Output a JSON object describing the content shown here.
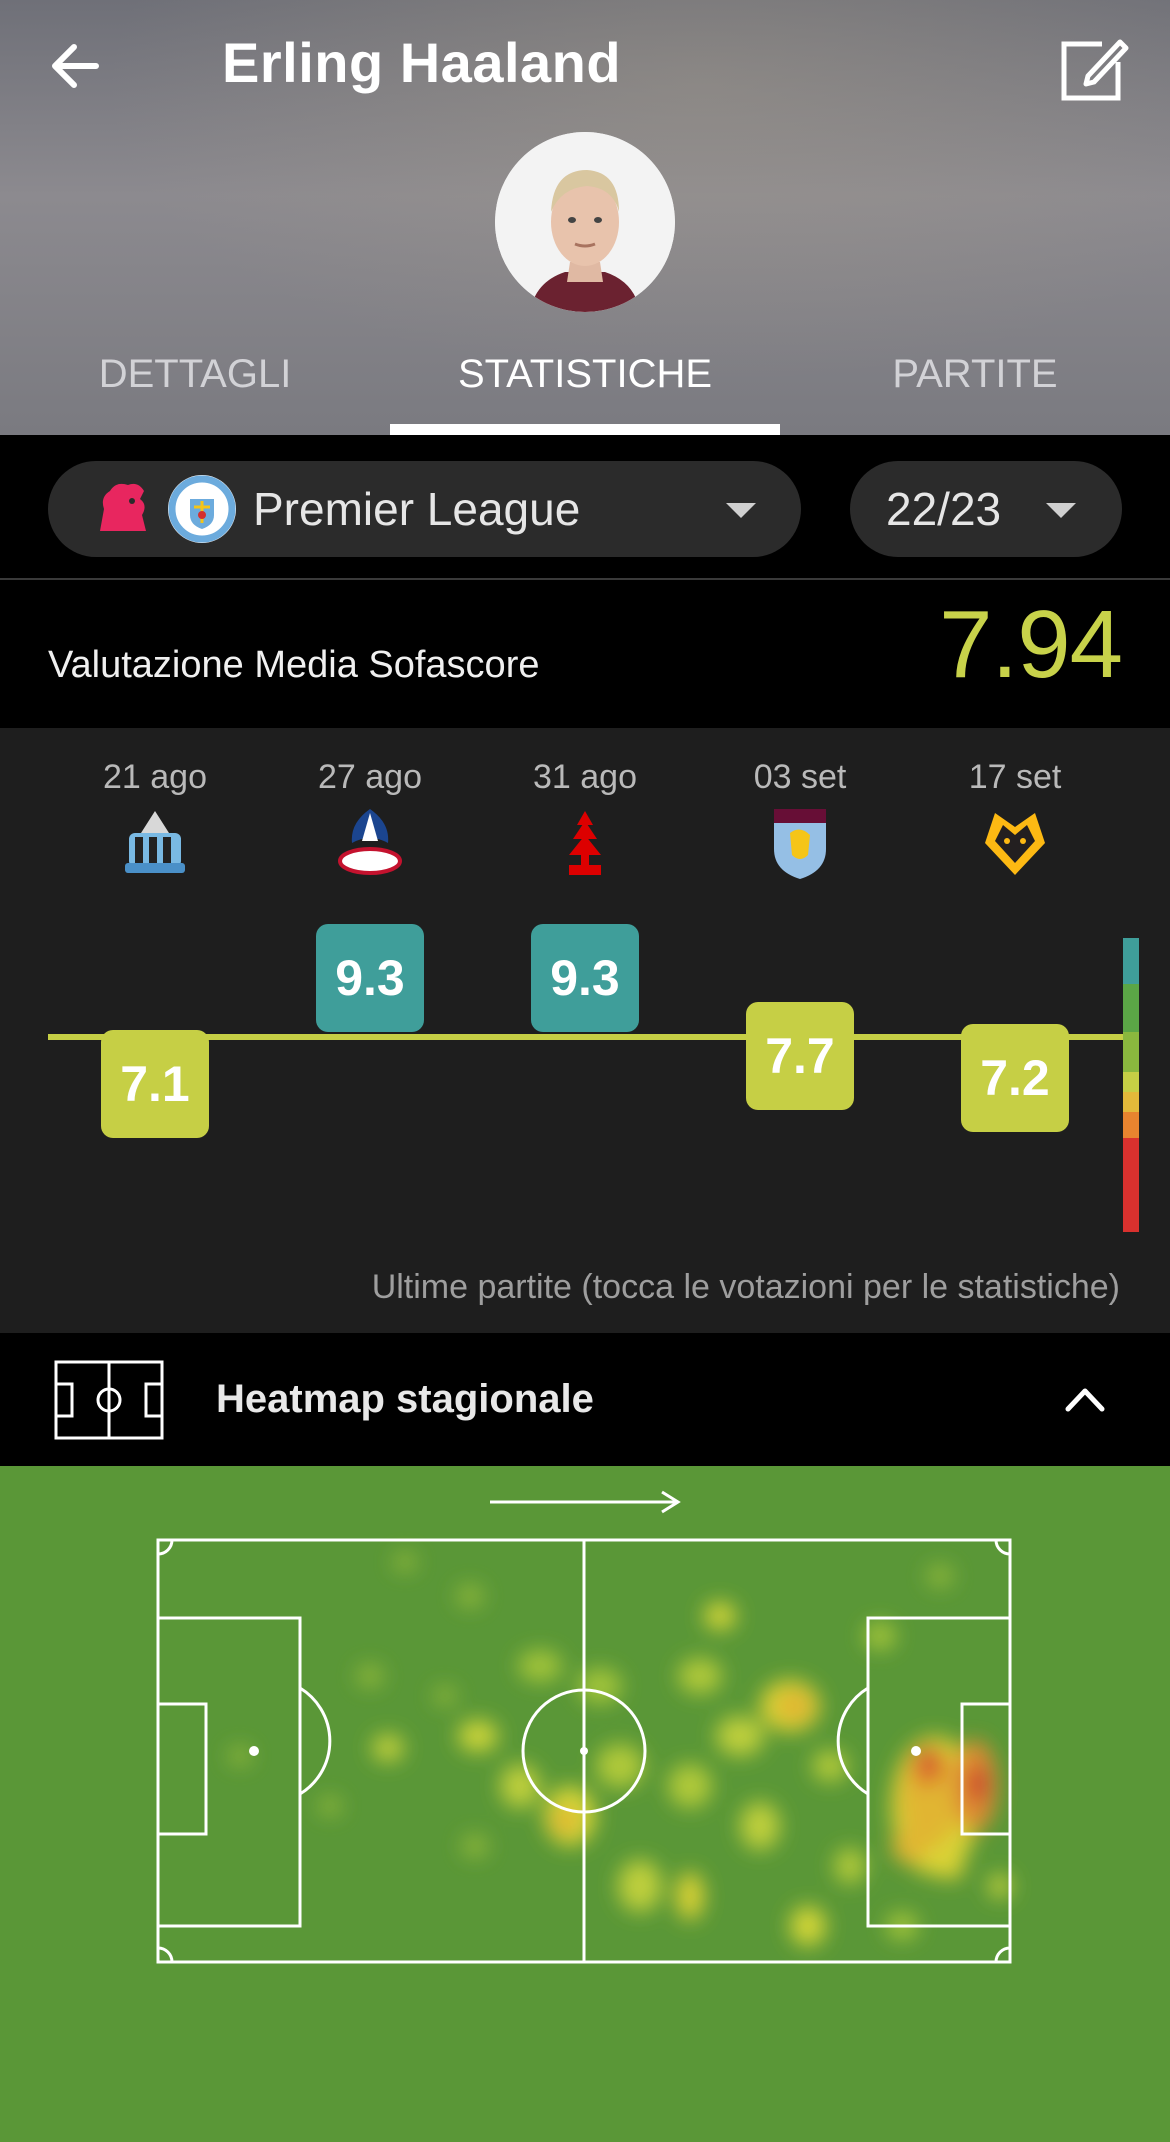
{
  "header": {
    "title": "Erling Haaland",
    "tabs": [
      {
        "label": "DETTAGLI",
        "active": false
      },
      {
        "label": "STATISTICHE",
        "active": true
      },
      {
        "label": "PARTITE",
        "active": false
      }
    ]
  },
  "filters": {
    "competition": "Premier League",
    "season": "22/23"
  },
  "average": {
    "label": "Valutazione Media Sofascore",
    "value": "7.94"
  },
  "matches": [
    {
      "date": "21 ago",
      "opponent_crest": "newcastle-crest",
      "rating": "7.1",
      "color": "#c6cf45"
    },
    {
      "date": "27 ago",
      "opponent_crest": "crystal-palace-crest",
      "rating": "9.3",
      "color": "#3f9e9a"
    },
    {
      "date": "31 ago",
      "opponent_crest": "nottingham-forest-crest",
      "rating": "9.3",
      "color": "#3f9e9a"
    },
    {
      "date": "03 set",
      "opponent_crest": "aston-villa-crest",
      "rating": "7.7",
      "color": "#c6cf45"
    },
    {
      "date": "17 set",
      "opponent_crest": "wolves-crest",
      "rating": "7.2",
      "color": "#c6cf45"
    }
  ],
  "footnote": "Ultime partite (tocca le votazioni per le statistiche)",
  "heatmap": {
    "title": "Heatmap stagionale"
  },
  "colors": {
    "accent": "#c6cf45",
    "top_rating": "#3f9e9a",
    "pitch": "#5a9737"
  }
}
